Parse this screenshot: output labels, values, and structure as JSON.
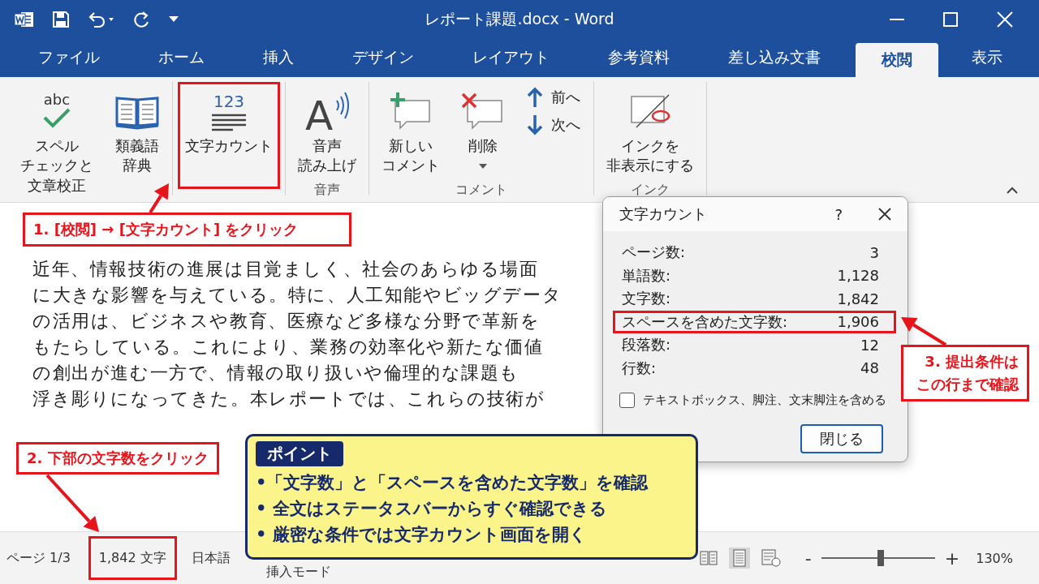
{
  "window": {
    "title": "レポート課題.docx - Word"
  },
  "tabs": [
    {
      "label": "ファイル",
      "selected": false
    },
    {
      "label": "ホーム",
      "selected": false
    },
    {
      "label": "挿入",
      "selected": false
    },
    {
      "label": "デザイン",
      "selected": false
    },
    {
      "label": "レイアウト",
      "selected": false
    },
    {
      "label": "参考資料",
      "selected": false
    },
    {
      "label": "差し込み文書",
      "selected": false
    },
    {
      "label": "校閲",
      "selected": true
    },
    {
      "label": "表示",
      "selected": false
    }
  ],
  "ribbon": {
    "groups": [
      {
        "commands": [
          {
            "kind": "spell",
            "icon_text": "abc",
            "label_lines": [
              "スペル",
              "チェックと",
              "文章校正"
            ],
            "highlighted": false
          },
          {
            "kind": "thesaurus",
            "label_lines": [
              "類義語",
              "辞典"
            ],
            "highlighted": false
          }
        ]
      },
      {
        "commands": [
          {
            "kind": "word-count",
            "icon_text": "123",
            "label_lines": [
              "文字カウント"
            ],
            "highlighted": true
          }
        ]
      },
      {
        "label": "音声",
        "commands": [
          {
            "kind": "read-aloud",
            "icon_text": "A",
            "label_lines": [
              "音声",
              "読み上げ"
            ],
            "highlighted": false
          }
        ]
      },
      {
        "label": "コメント",
        "commands": [
          {
            "kind": "new-comment",
            "label_lines": [
              "新しい",
              "コメント"
            ],
            "highlighted": false
          },
          {
            "kind": "delete-comment",
            "label_lines": [
              "削除"
            ],
            "highlighted": false
          },
          {
            "kind": "nav",
            "items": [
              {
                "kind": "up",
                "label": "前へ"
              },
              {
                "kind": "down",
                "label": "次へ"
              }
            ]
          }
        ]
      },
      {
        "label": "インク",
        "commands": [
          {
            "kind": "ink",
            "label_lines": [
              "インクを",
              "非表示にする"
            ],
            "highlighted": false
          }
        ]
      }
    ]
  },
  "document": {
    "lines": [
      "近年、情報技術の進展は目覚ましく、社会のあらゆる場面",
      "に大きな影響を与えている。特に、人工知能やビッグデータ",
      "の活用は、ビジネスや教育、医療など多様な分野で革新を",
      "もたらしている。これにより、業務の効率化や新たな価値",
      "の創出が進む一方で、情報の取り扱いや倫理的な課題も",
      "浮き彫りになってきた。本レポートでは、これらの技術が"
    ]
  },
  "dialog": {
    "title": "文字カウント",
    "help": "?",
    "stats": [
      {
        "label": "ページ数:",
        "value": "3",
        "highlighted": false
      },
      {
        "label": "単語数:",
        "value": "1,128",
        "highlighted": false
      },
      {
        "label": "文字数:",
        "value": "1,842",
        "highlighted": false
      },
      {
        "label": "スペースを含めた文字数:",
        "value": "1,906",
        "highlighted": true
      },
      {
        "label": "段落数:",
        "value": "12",
        "highlighted": false
      },
      {
        "label": "行数:",
        "value": "48",
        "highlighted": false
      }
    ],
    "checkbox": {
      "label": "テキストボックス、脚注、文末脚注を含める",
      "checked": false
    },
    "close_button": "閉じる"
  },
  "annotations": [
    {
      "lines": [
        "1. [校閲] → [文字カウント] をクリック"
      ]
    },
    {
      "lines": [
        "2. 下部の文字数をクリック"
      ]
    },
    {
      "lines": [
        "3. 提出条件は",
        "この行まで確認"
      ]
    }
  ],
  "callout": {
    "title": "ポイント",
    "bullets": [
      "•「文字数」と「スペースを含めた文字数」を確認",
      "• 全文はステータスバーからすぐ確認できる",
      "• 厳密な条件では文字カウント画面を開く"
    ]
  },
  "status_bar": {
    "page": "ページ 1/3",
    "word_count": {
      "text": "1,842 文字",
      "highlighted": true
    },
    "language": "日本語",
    "mode": "挿入モード",
    "zoom_out": "-",
    "zoom_in": "+",
    "zoom": {
      "level": 0.52,
      "reading": "130%"
    }
  }
}
